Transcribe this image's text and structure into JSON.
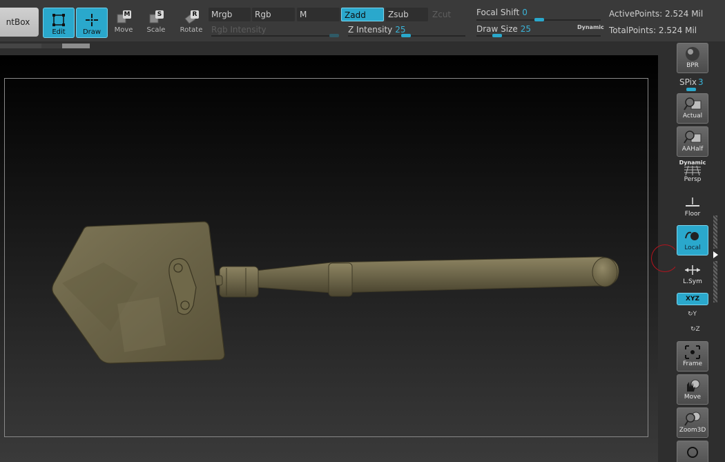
{
  "toolbar": {
    "lightbox_label": "ntBox",
    "edit_label": "Edit",
    "draw_label": "Draw",
    "move_label": "Move",
    "move_key": "M",
    "scale_label": "Scale",
    "scale_key": "S",
    "rotate_label": "Rotate",
    "rotate_key": "R",
    "mrgb": "Mrgb",
    "rgb": "Rgb",
    "m": "M",
    "zadd": "Zadd",
    "zsub": "Zsub",
    "zcut": "Zcut",
    "rgb_intensity_label": "Rgb Intensity",
    "z_intensity_label": "Z Intensity",
    "z_intensity_value": "25",
    "focal_shift_label": "Focal Shift",
    "focal_shift_value": "0",
    "draw_size_label": "Draw Size",
    "draw_size_value": "25",
    "dynamic_label": "Dynamic",
    "active_points": "ActivePoints: 2.524 Mil",
    "total_points": "TotalPoints: 2.524 Mil"
  },
  "shelf": {
    "bpr_label": "BPR",
    "spix_label": "SPix",
    "spix_value": "3",
    "actual_label": "Actual",
    "aahalf_label": "AAHalf",
    "persp_dynamic_label": "Dynamic",
    "persp_label": "Persp",
    "floor_label": "Floor",
    "local_label": "Local",
    "lsym_label": "L.Sym",
    "xyz_label": "XYZ",
    "rot_y_label": "Y",
    "rot_z_label": "Z",
    "frame_label": "Frame",
    "move_label": "Move",
    "zoom3d_label": "Zoom3D"
  },
  "colors": {
    "accent": "#2aa8cc",
    "model": "#6d664a",
    "background": "#2e2e2e"
  }
}
